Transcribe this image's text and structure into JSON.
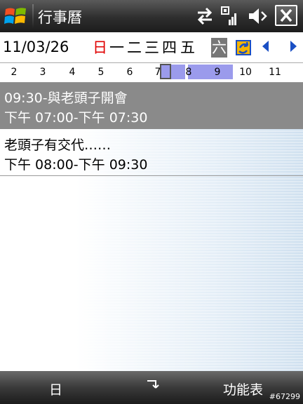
{
  "titlebar": {
    "app_title": "行事曆",
    "icons": [
      "windows-start-icon",
      "connectivity-icon",
      "signal-icon",
      "volume-icon",
      "close-icon"
    ]
  },
  "week": {
    "date": "11/03/26",
    "days": [
      "日",
      "一",
      "二",
      "三",
      "四",
      "五",
      "六"
    ],
    "selected_day_index": 6,
    "icons": [
      "go-to-today-icon",
      "previous-week-icon",
      "next-week-icon"
    ]
  },
  "hours": [
    "2",
    "3",
    "4",
    "5",
    "6",
    "7",
    "8",
    "9",
    "10",
    "11"
  ],
  "appointments": [
    {
      "subject": "09:30-與老頭子開會",
      "time": "下午 07:00-下午 07:30"
    },
    {
      "subject": "老頭子有交代……",
      "time": "下午 08:00-下午 09:30"
    }
  ],
  "softkeys": {
    "left": "日",
    "right": "功能表"
  },
  "watermark": "#67299",
  "colors": {
    "sunday": "#e00000",
    "busy": "#9b9bec",
    "selected_row": "#8a8a8a",
    "nav_arrow": "#1a4fc4"
  }
}
